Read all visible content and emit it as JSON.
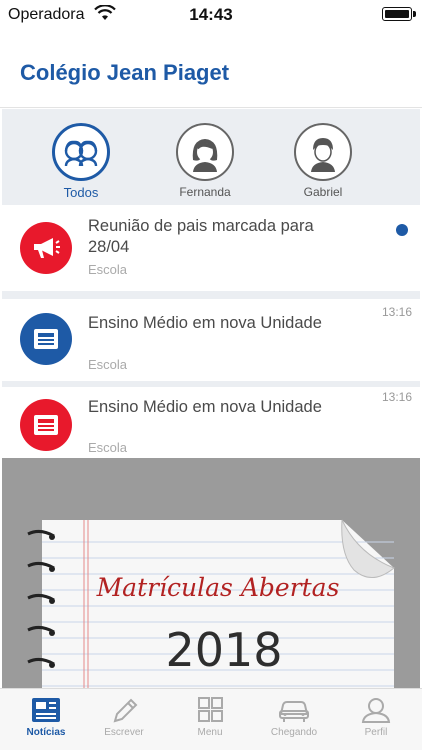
{
  "status_bar": {
    "carrier": "Operadora",
    "time": "14:43"
  },
  "header": {
    "title": "Colégio Jean Piaget"
  },
  "filters": [
    {
      "label": "Todos",
      "icon": "two-people-icon",
      "active": true
    },
    {
      "label": "Fernanda",
      "icon": "girl-avatar-icon",
      "active": false
    },
    {
      "label": "Gabriel",
      "icon": "boy-avatar-icon",
      "active": false
    }
  ],
  "news": [
    {
      "title": "Reunião de pais marcada para 28/04",
      "source": "Escola",
      "time": "",
      "unread": true,
      "icon": "megaphone-icon",
      "icon_color": "#e8192c"
    },
    {
      "title": "Ensino Médio em nova Unidade",
      "source": "Escola",
      "time": "13:16",
      "unread": false,
      "icon": "newspaper-icon",
      "icon_color": "#1e5aa6"
    },
    {
      "title": "Ensino Médio em nova Unidade",
      "source": "Escola",
      "time": "13:16",
      "unread": false,
      "icon": "newspaper-icon",
      "icon_color": "#e8192c"
    }
  ],
  "banner": {
    "headline": "Matrículas Abertas",
    "year": "2018"
  },
  "tabs": [
    {
      "label": "Notícias",
      "icon": "news-icon",
      "active": true
    },
    {
      "label": "Escrever",
      "icon": "pencil-icon",
      "active": false
    },
    {
      "label": "Menu",
      "icon": "grid-icon",
      "active": false
    },
    {
      "label": "Chegando",
      "icon": "car-icon",
      "active": false
    },
    {
      "label": "Perfil",
      "icon": "person-icon",
      "active": false
    }
  ],
  "colors": {
    "brand": "#1e5aa6",
    "alert": "#e8192c",
    "strip": "#ebeef2"
  }
}
